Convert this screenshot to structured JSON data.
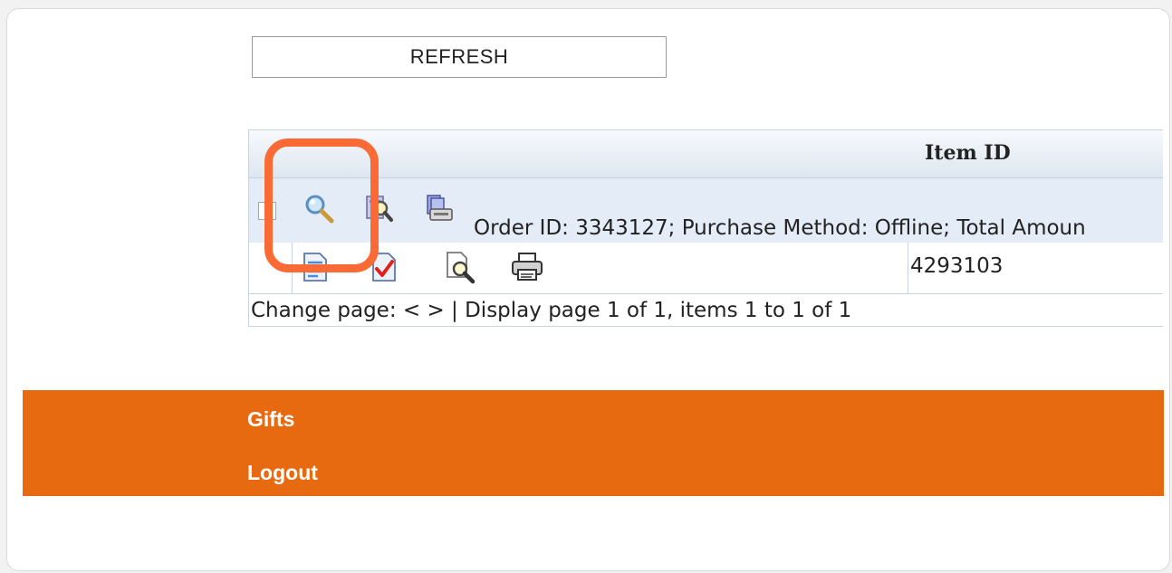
{
  "toolbar": {
    "refresh_label": "REFRESH"
  },
  "grid": {
    "header": {
      "item_id": "Item ID"
    },
    "group": {
      "summary": "Order ID: 3343127; Purchase Method: Offline; Total Amoun"
    },
    "row": {
      "item_id": "4293103"
    },
    "pager": {
      "text": "Change page: < > | Display page 1 of 1, items 1 to 1 of 1"
    }
  },
  "menu": {
    "items": [
      {
        "label": "Gifts"
      },
      {
        "label": "Logout"
      }
    ]
  },
  "colors": {
    "menu_background": "#e86a10",
    "highlight": "#fa6a35",
    "group_row": "#e4ecf7"
  }
}
